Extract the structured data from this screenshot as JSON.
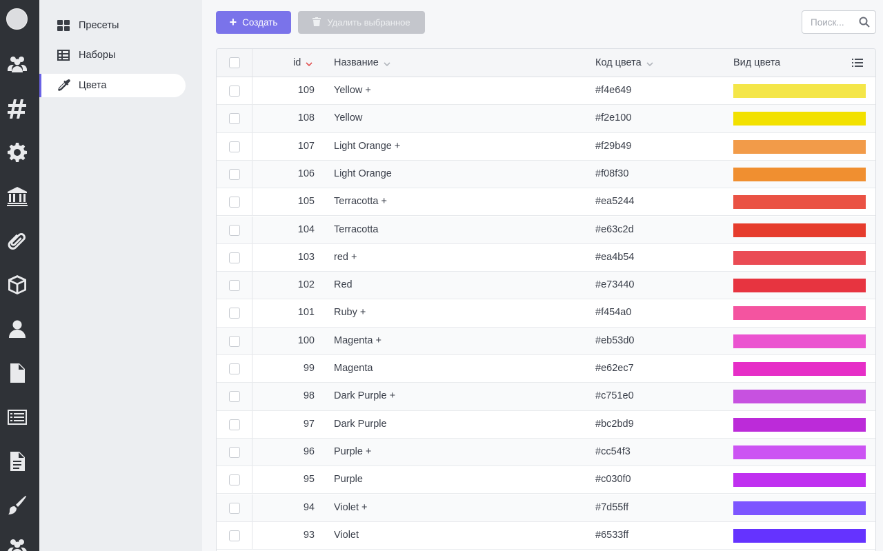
{
  "rail": {
    "icons": [
      "avatar",
      "users-icon",
      "hashtag-icon",
      "gear-icon",
      "bank-icon",
      "paperclip-icon",
      "cube-icon",
      "user-icon",
      "file-icon",
      "list-icon",
      "file-text-icon",
      "paintbrush-icon",
      "users-icon"
    ]
  },
  "subnav": {
    "items": [
      {
        "label": "Пресеты",
        "icon": "grid-icon",
        "active": false
      },
      {
        "label": "Наборы",
        "icon": "table-icon",
        "active": false
      },
      {
        "label": "Цвета",
        "icon": "eyedropper-icon",
        "active": true
      }
    ]
  },
  "toolbar": {
    "create_label": "Создать",
    "delete_label": "Удалить выбранное",
    "search_placeholder": "Поиск..."
  },
  "table": {
    "headers": {
      "id": "id",
      "name": "Название",
      "code": "Код цвета",
      "preview": "Вид цвета"
    },
    "sort": {
      "column": "id",
      "direction": "desc"
    },
    "rows": [
      {
        "id": "109",
        "name": "Yellow +",
        "code": "#f4e649"
      },
      {
        "id": "108",
        "name": "Yellow",
        "code": "#f2e100"
      },
      {
        "id": "107",
        "name": "Light Orange +",
        "code": "#f29b49"
      },
      {
        "id": "106",
        "name": "Light Orange",
        "code": "#f08f30"
      },
      {
        "id": "105",
        "name": "Terracotta +",
        "code": "#ea5244"
      },
      {
        "id": "104",
        "name": "Terracotta",
        "code": "#e63c2d"
      },
      {
        "id": "103",
        "name": "red +",
        "code": "#ea4b54"
      },
      {
        "id": "102",
        "name": "Red",
        "code": "#e73440"
      },
      {
        "id": "101",
        "name": "Ruby +",
        "code": "#f454a0"
      },
      {
        "id": "100",
        "name": "Magenta +",
        "code": "#eb53d0"
      },
      {
        "id": "99",
        "name": "Magenta",
        "code": "#e62ec7"
      },
      {
        "id": "98",
        "name": "Dark Purple +",
        "code": "#c751e0"
      },
      {
        "id": "97",
        "name": "Dark Purple",
        "code": "#bc2bd9"
      },
      {
        "id": "96",
        "name": "Purple +",
        "code": "#cc54f3"
      },
      {
        "id": "95",
        "name": "Purple",
        "code": "#c030f0"
      },
      {
        "id": "94",
        "name": "Violet +",
        "code": "#7d55ff"
      },
      {
        "id": "93",
        "name": "Violet",
        "code": "#6533ff"
      }
    ]
  },
  "colors": {
    "accent": "#7a73ea",
    "rail": "#2f3237",
    "sort_active": "#e25353"
  }
}
